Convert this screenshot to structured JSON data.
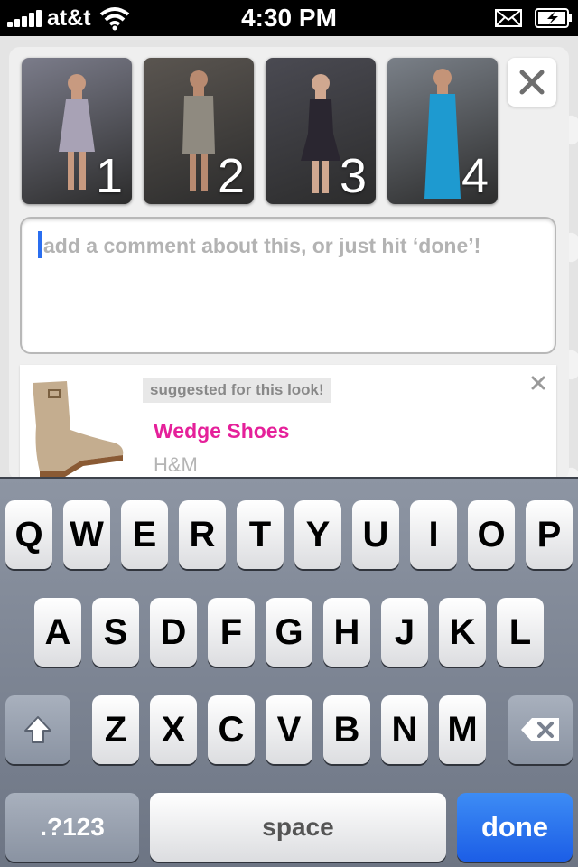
{
  "status_bar": {
    "carrier": "at&t",
    "time": "4:30 PM"
  },
  "photos": [
    {
      "number": "1",
      "dress_color": "#a8a2b5",
      "bg_color": "#7b7c8a"
    },
    {
      "number": "2",
      "dress_color": "#8f8a80",
      "bg_color": "#5a5550"
    },
    {
      "number": "3",
      "dress_color": "#2a2630",
      "bg_color": "#4a4a52"
    },
    {
      "number": "4",
      "dress_color": "#1e9ad0",
      "bg_color": "#7a8088"
    }
  ],
  "comment": {
    "placeholder": "add a comment about this, or just hit ‘done’!",
    "value": ""
  },
  "suggestion": {
    "tag": "suggested for this look!",
    "product_name": "Wedge Shoes",
    "brand": "H&M",
    "product_name_color": "#e5209a"
  },
  "keyboard": {
    "row1": [
      "Q",
      "W",
      "E",
      "R",
      "T",
      "Y",
      "U",
      "I",
      "O",
      "P"
    ],
    "row2": [
      "A",
      "S",
      "D",
      "F",
      "G",
      "H",
      "J",
      "K",
      "L"
    ],
    "row3": [
      "Z",
      "X",
      "C",
      "V",
      "B",
      "N",
      "M"
    ],
    "numbers_label": ".?123",
    "space_label": "space",
    "done_label": "done"
  }
}
